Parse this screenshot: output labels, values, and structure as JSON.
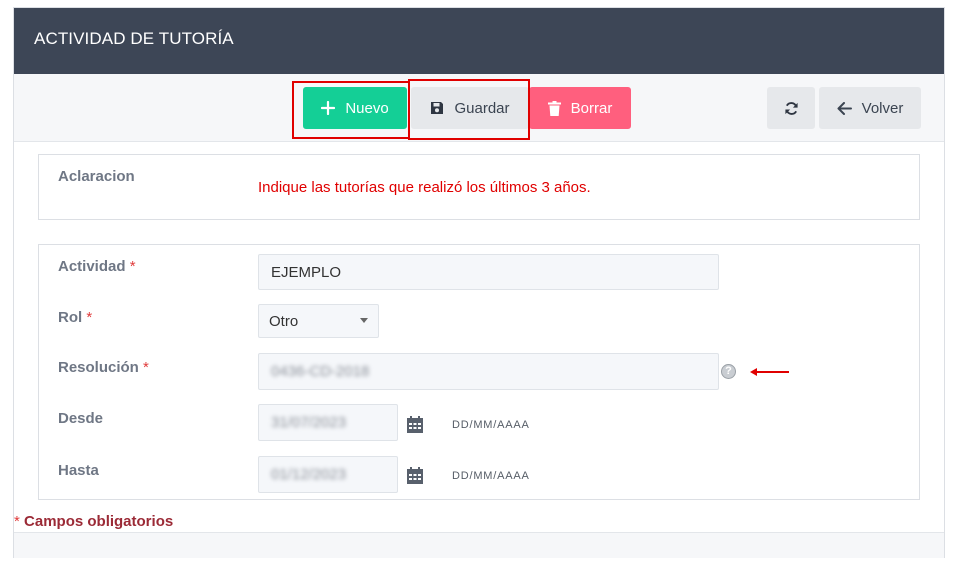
{
  "header": {
    "title": "ACTIVIDAD DE TUTORÍA"
  },
  "toolbar": {
    "nuevo_label": "Nuevo",
    "guardar_label": "Guardar",
    "borrar_label": "Borrar",
    "volver_label": "Volver"
  },
  "aclaracion": {
    "label": "Aclaracion",
    "text": "Indique las tutorías que realizó los últimos 3 años."
  },
  "form": {
    "required_mark": "*",
    "actividad": {
      "label": "Actividad",
      "value": "EJEMPLO"
    },
    "rol": {
      "label": "Rol",
      "selected": "Otro"
    },
    "resolucion": {
      "label": "Resolución",
      "value": "0436-CD-2018",
      "help": "?"
    },
    "desde": {
      "label": "Desde",
      "value": "31/07/2023",
      "format": "DD/MM/AAAA"
    },
    "hasta": {
      "label": "Hasta",
      "value": "01/12/2023",
      "format": "DD/MM/AAAA"
    }
  },
  "footer": {
    "star": "*",
    "note": "Campos obligatorios"
  },
  "colors": {
    "header_bg": "#3d4656",
    "nuevo": "#14cf96",
    "borrar": "#ff5f7e",
    "highlight": "#e00000",
    "required": "#e03b3b"
  },
  "icons": {
    "nuevo": "plus-icon",
    "guardar": "floppy-disk-icon",
    "borrar": "trash-icon",
    "refresh": "refresh-icon",
    "volver": "arrow-left-icon",
    "calendar": "calendar-icon",
    "help": "question-circle-icon",
    "annotation": "red-arrow-left-icon"
  }
}
